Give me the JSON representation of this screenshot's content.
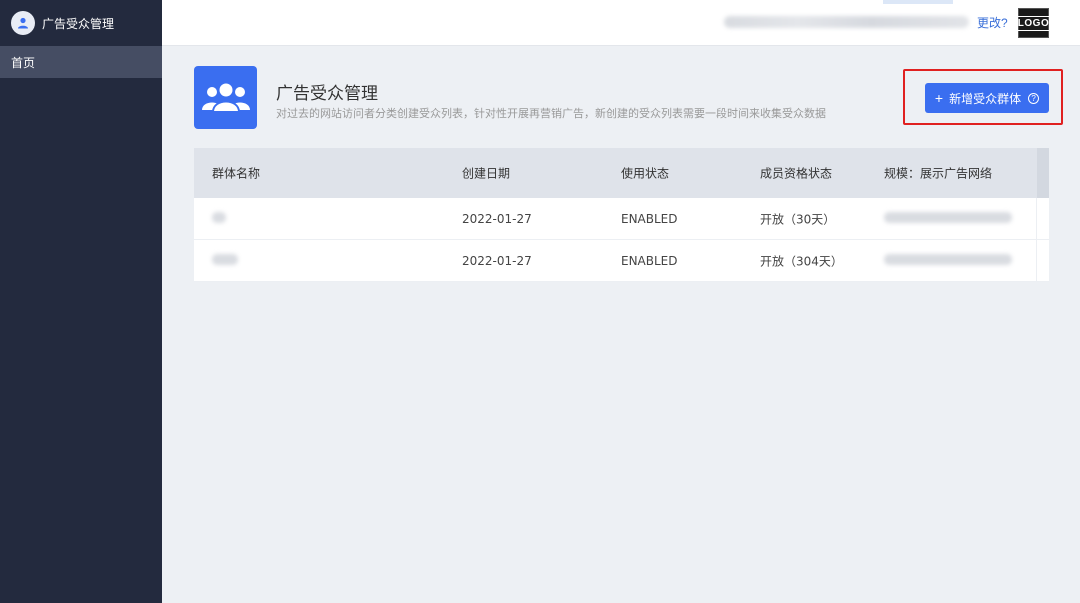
{
  "sidebar": {
    "brand_title": "广告受众管理",
    "items": [
      {
        "label": "首页",
        "active": true
      }
    ]
  },
  "topbar": {
    "change_link": "更改?",
    "logo_text": "LOGO"
  },
  "page": {
    "title": "广告受众管理",
    "description": "对过去的网站访问者分类创建受众列表，针对性开展再营销广告，新创建的受众列表需要一段时间来收集受众数据",
    "add_button_label": "新增受众群体",
    "add_button_icon": "plus-icon",
    "help_icon": "question-circle-icon"
  },
  "table": {
    "columns": [
      "群体名称",
      "创建日期",
      "使用状态",
      "成员资格状态",
      "规模：展示广告网络"
    ],
    "rows": [
      {
        "created": "2022-01-27",
        "status": "ENABLED",
        "membership": "开放（30天）"
      },
      {
        "created": "2022-01-27",
        "status": "ENABLED",
        "membership": "开放（304天）"
      }
    ]
  },
  "colors": {
    "sidebar_bg": "#232a3e",
    "accent": "#3a6ef0",
    "highlight": "#e02020"
  }
}
